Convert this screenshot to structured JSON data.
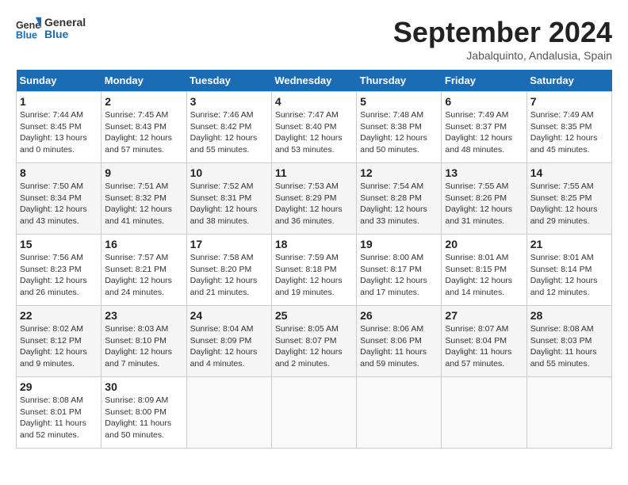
{
  "header": {
    "logo": {
      "line1": "General",
      "line2": "Blue"
    },
    "title": "September 2024",
    "location": "Jabalquinto, Andalusia, Spain"
  },
  "weekdays": [
    "Sunday",
    "Monday",
    "Tuesday",
    "Wednesday",
    "Thursday",
    "Friday",
    "Saturday"
  ],
  "weeks": [
    [
      {
        "day": "1",
        "sunrise": "7:44 AM",
        "sunset": "8:45 PM",
        "daylight": "13 hours and 0 minutes."
      },
      {
        "day": "2",
        "sunrise": "7:45 AM",
        "sunset": "8:43 PM",
        "daylight": "12 hours and 57 minutes."
      },
      {
        "day": "3",
        "sunrise": "7:46 AM",
        "sunset": "8:42 PM",
        "daylight": "12 hours and 55 minutes."
      },
      {
        "day": "4",
        "sunrise": "7:47 AM",
        "sunset": "8:40 PM",
        "daylight": "12 hours and 53 minutes."
      },
      {
        "day": "5",
        "sunrise": "7:48 AM",
        "sunset": "8:38 PM",
        "daylight": "12 hours and 50 minutes."
      },
      {
        "day": "6",
        "sunrise": "7:49 AM",
        "sunset": "8:37 PM",
        "daylight": "12 hours and 48 minutes."
      },
      {
        "day": "7",
        "sunrise": "7:49 AM",
        "sunset": "8:35 PM",
        "daylight": "12 hours and 45 minutes."
      }
    ],
    [
      {
        "day": "8",
        "sunrise": "7:50 AM",
        "sunset": "8:34 PM",
        "daylight": "12 hours and 43 minutes."
      },
      {
        "day": "9",
        "sunrise": "7:51 AM",
        "sunset": "8:32 PM",
        "daylight": "12 hours and 41 minutes."
      },
      {
        "day": "10",
        "sunrise": "7:52 AM",
        "sunset": "8:31 PM",
        "daylight": "12 hours and 38 minutes."
      },
      {
        "day": "11",
        "sunrise": "7:53 AM",
        "sunset": "8:29 PM",
        "daylight": "12 hours and 36 minutes."
      },
      {
        "day": "12",
        "sunrise": "7:54 AM",
        "sunset": "8:28 PM",
        "daylight": "12 hours and 33 minutes."
      },
      {
        "day": "13",
        "sunrise": "7:55 AM",
        "sunset": "8:26 PM",
        "daylight": "12 hours and 31 minutes."
      },
      {
        "day": "14",
        "sunrise": "7:55 AM",
        "sunset": "8:25 PM",
        "daylight": "12 hours and 29 minutes."
      }
    ],
    [
      {
        "day": "15",
        "sunrise": "7:56 AM",
        "sunset": "8:23 PM",
        "daylight": "12 hours and 26 minutes."
      },
      {
        "day": "16",
        "sunrise": "7:57 AM",
        "sunset": "8:21 PM",
        "daylight": "12 hours and 24 minutes."
      },
      {
        "day": "17",
        "sunrise": "7:58 AM",
        "sunset": "8:20 PM",
        "daylight": "12 hours and 21 minutes."
      },
      {
        "day": "18",
        "sunrise": "7:59 AM",
        "sunset": "8:18 PM",
        "daylight": "12 hours and 19 minutes."
      },
      {
        "day": "19",
        "sunrise": "8:00 AM",
        "sunset": "8:17 PM",
        "daylight": "12 hours and 17 minutes."
      },
      {
        "day": "20",
        "sunrise": "8:01 AM",
        "sunset": "8:15 PM",
        "daylight": "12 hours and 14 minutes."
      },
      {
        "day": "21",
        "sunrise": "8:01 AM",
        "sunset": "8:14 PM",
        "daylight": "12 hours and 12 minutes."
      }
    ],
    [
      {
        "day": "22",
        "sunrise": "8:02 AM",
        "sunset": "8:12 PM",
        "daylight": "12 hours and 9 minutes."
      },
      {
        "day": "23",
        "sunrise": "8:03 AM",
        "sunset": "8:10 PM",
        "daylight": "12 hours and 7 minutes."
      },
      {
        "day": "24",
        "sunrise": "8:04 AM",
        "sunset": "8:09 PM",
        "daylight": "12 hours and 4 minutes."
      },
      {
        "day": "25",
        "sunrise": "8:05 AM",
        "sunset": "8:07 PM",
        "daylight": "12 hours and 2 minutes."
      },
      {
        "day": "26",
        "sunrise": "8:06 AM",
        "sunset": "8:06 PM",
        "daylight": "11 hours and 59 minutes."
      },
      {
        "day": "27",
        "sunrise": "8:07 AM",
        "sunset": "8:04 PM",
        "daylight": "11 hours and 57 minutes."
      },
      {
        "day": "28",
        "sunrise": "8:08 AM",
        "sunset": "8:03 PM",
        "daylight": "11 hours and 55 minutes."
      }
    ],
    [
      {
        "day": "29",
        "sunrise": "8:08 AM",
        "sunset": "8:01 PM",
        "daylight": "11 hours and 52 minutes."
      },
      {
        "day": "30",
        "sunrise": "8:09 AM",
        "sunset": "8:00 PM",
        "daylight": "11 hours and 50 minutes."
      },
      null,
      null,
      null,
      null,
      null
    ]
  ]
}
